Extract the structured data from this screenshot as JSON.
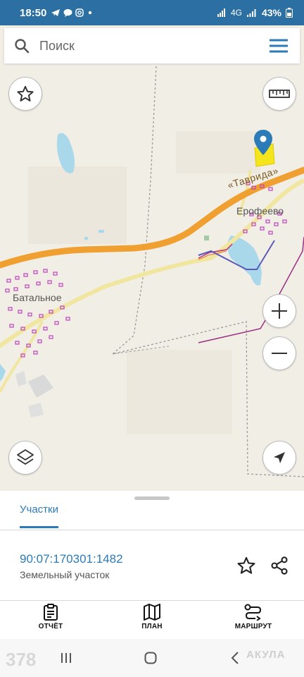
{
  "status_bar": {
    "time": "18:50",
    "notification_icons": [
      "telegram-icon",
      "message-icon",
      "instagram-icon",
      "dot-icon"
    ],
    "signal_text": "4G",
    "battery": "43%"
  },
  "search": {
    "placeholder": "Поиск"
  },
  "map": {
    "labels": {
      "road": "«Таврида»",
      "village_1": "Ерофеево",
      "village_2": "Батальное"
    },
    "colors": {
      "background": "#f1eee6",
      "highway": "#f0a030",
      "road": "#f0e6a0",
      "water": "#a8d8ea",
      "marker": "#2b7bb9",
      "parcel_highlight": "#f5e51c"
    }
  },
  "sheet": {
    "tab_label": "Участки",
    "cadastral_number": "90:07:170301:1482",
    "parcel_type": "Земельный участок"
  },
  "bottom_nav": {
    "report": "ОТЧЁТ",
    "plan": "ПЛАН",
    "route": "МАРШРУТ"
  },
  "watermark": {
    "number": "378",
    "brand": "АКУЛА"
  }
}
